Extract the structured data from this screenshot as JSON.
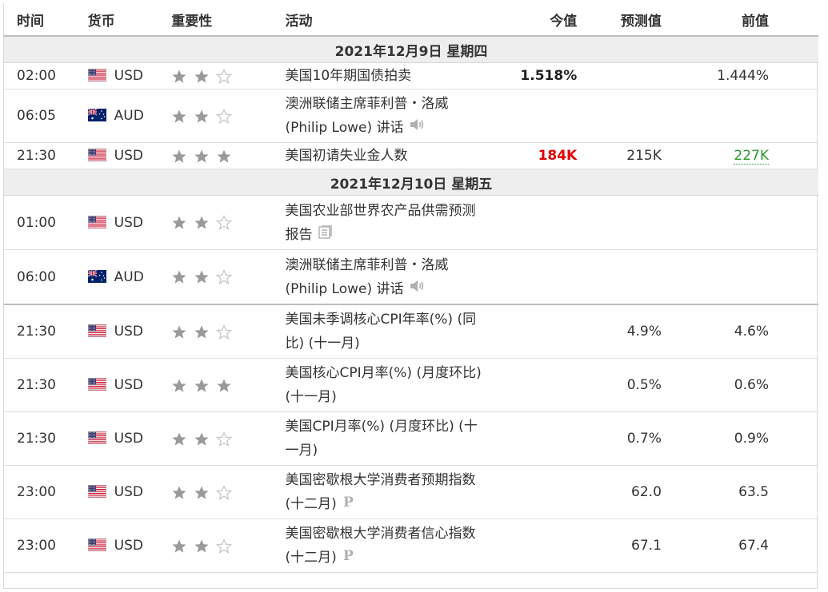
{
  "header": {
    "time": "时间",
    "currency": "货币",
    "importance": "重要性",
    "event": "活动",
    "actual": "今值",
    "forecast": "预测值",
    "previous": "前值"
  },
  "groups": [
    {
      "date": "2021年12月9日  星期四",
      "rows": [
        {
          "time": "02:00",
          "flag": "us",
          "currency": "USD",
          "stars": 2,
          "event": "美国10年期国债拍卖",
          "actual": "1.518%",
          "forecast": "",
          "previous": "1.444%",
          "icon": ""
        },
        {
          "time": "06:05",
          "flag": "au",
          "currency": "AUD",
          "stars": 2,
          "event": "澳洲联储主席菲利普・洛威 (Philip Lowe) 讲话",
          "actual": "",
          "forecast": "",
          "previous": "",
          "icon": "speaker-icon"
        },
        {
          "time": "21:30",
          "flag": "us",
          "currency": "USD",
          "stars": 3,
          "event": "美国初请失业金人数",
          "actual": "184K",
          "actual_color": "#e00000",
          "forecast": "215K",
          "previous": "227K",
          "previous_color": "#2a9a2a",
          "icon": ""
        }
      ]
    },
    {
      "date": "2021年12月10日  星期五",
      "rows": [
        {
          "time": "01:00",
          "flag": "us",
          "currency": "USD",
          "stars": 2,
          "event": "美国农业部世界农产品供需预测报告",
          "actual": "",
          "forecast": "",
          "previous": "",
          "icon": "document-icon"
        },
        {
          "time": "06:00",
          "flag": "au",
          "currency": "AUD",
          "stars": 2,
          "event": "澳洲联储主席菲利普・洛威 (Philip Lowe) 讲话",
          "actual": "",
          "forecast": "",
          "previous": "",
          "icon": "speaker-icon"
        },
        {
          "time": "21:30",
          "flag": "us",
          "currency": "USD",
          "stars": 2,
          "event": "美国未季调核心CPI年率(%) (同比) (十一月)",
          "actual": "",
          "forecast": "4.9%",
          "previous": "4.6%",
          "icon": ""
        },
        {
          "time": "21:30",
          "flag": "us",
          "currency": "USD",
          "stars": 3,
          "event": "美国核心CPI月率(%) (月度环比) (十一月)",
          "actual": "",
          "forecast": "0.5%",
          "previous": "0.6%",
          "icon": ""
        },
        {
          "time": "21:30",
          "flag": "us",
          "currency": "USD",
          "stars": 2,
          "event": "美国CPI月率(%) (月度环比) (十一月)",
          "actual": "",
          "forecast": "0.7%",
          "previous": "0.9%",
          "icon": ""
        },
        {
          "time": "23:00",
          "flag": "us",
          "currency": "USD",
          "stars": 2,
          "event": "美国密歇根大学消费者预期指数 (十二月)",
          "actual": "",
          "forecast": "62.0",
          "previous": "63.5",
          "icon": "preliminary-icon"
        },
        {
          "time": "23:00",
          "flag": "us",
          "currency": "USD",
          "stars": 2,
          "event": "美国密歇根大学消费者信心指数 (十二月)",
          "actual": "",
          "forecast": "67.1",
          "previous": "67.4",
          "icon": "preliminary-icon"
        }
      ]
    }
  ],
  "colors": {
    "star_filled": "#9a9a9a",
    "star_empty": "#c8c8c8",
    "date_bg": "#eeeeee"
  }
}
